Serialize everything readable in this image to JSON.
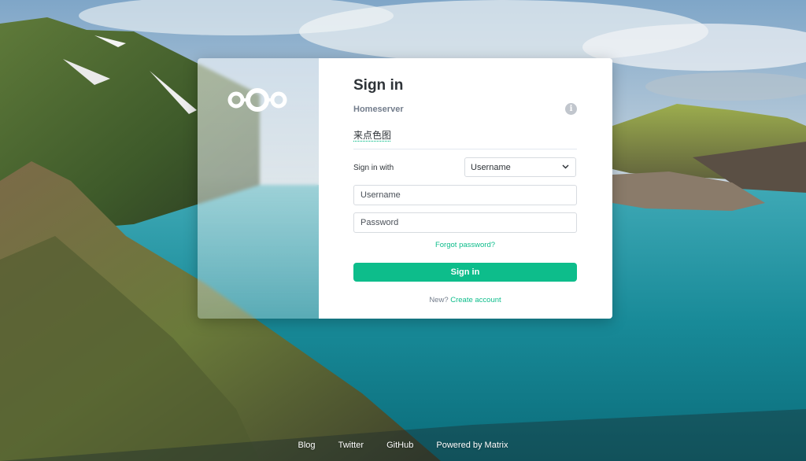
{
  "login": {
    "title": "Sign in",
    "homeserver_label": "Homeserver",
    "homeserver_info_icon": "info-icon",
    "homeserver_value": "来点色图",
    "signin_with_label": "Sign in with",
    "signin_with_selected": "Username",
    "username_placeholder": "Username",
    "password_placeholder": "Password",
    "forgot_password": "Forgot password?",
    "signin_button": "Sign in",
    "new_prefix": "New?",
    "create_account": "Create account"
  },
  "footer": {
    "links": [
      "Blog",
      "Twitter",
      "GitHub",
      "Powered by Matrix"
    ]
  },
  "colors": {
    "accent": "#0dbd8b",
    "text": "#2e3338",
    "muted": "#737d8c"
  }
}
